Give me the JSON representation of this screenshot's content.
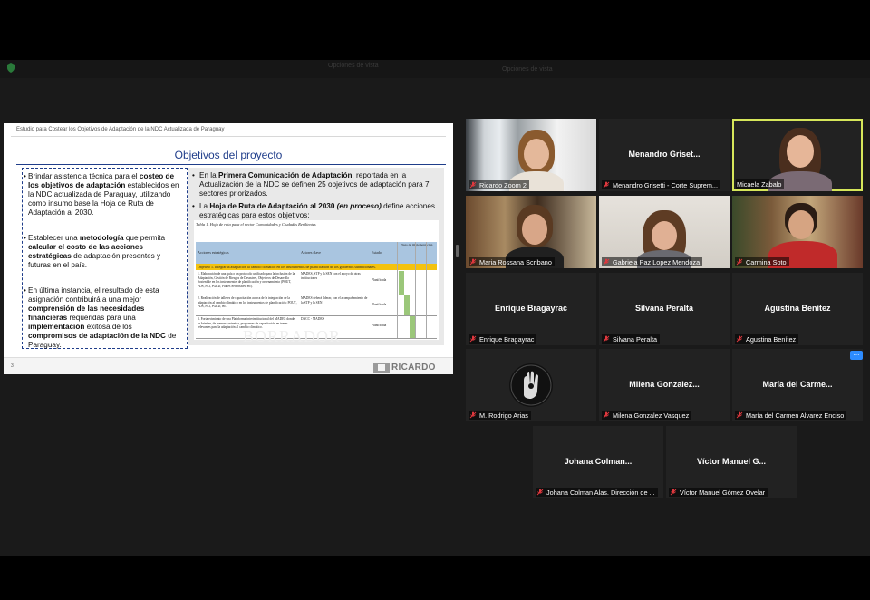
{
  "toolbar": {
    "view_label": "Opciones de vista",
    "view_label_2": "Opciones de vista"
  },
  "slide": {
    "header": "Estudio para Costear los Objetivos de Adaptación de la NDC Actualizada de Paraguay",
    "title": "Objetivos del proyecto",
    "left_items": [
      [
        "Brindar asistencia técnica para el ",
        "costeo de los objetivos de adaptación",
        " establecidos en la NDC actualizada de Paraguay, utilizando como insumo base la Hoja de Ruta de Adaptación al 2030."
      ],
      [
        "Establecer una ",
        "metodología",
        " que permita ",
        "calcular el costo de las acciones estratégicas",
        " de adaptación presentes y futuras en el país."
      ],
      [
        "En última instancia, el resultado de esta asignación contribuirá a una mejor ",
        "comprensión de las necesidades financieras",
        " requeridas para una ",
        "implementación",
        " exitosa de los ",
        "compromisos de adaptación de la NDC",
        " de Paraguay."
      ]
    ],
    "right_item_1": {
      "pre": "En la ",
      "bold": "Primera Comunicación de Adaptación",
      "post": ", reportada en la Actualización de la NDC se definen 25 objetivos de adaptación para 7 sectores priorizados."
    },
    "right_item_2": {
      "pre": "La ",
      "bold": "Hoja de Ruta de Adaptación al 2030",
      "ital": " (en proceso)",
      "post": " define acciones estratégicas para estos objetivos:"
    },
    "table": {
      "caption": "Tabla 1. Hoja de ruta para el sector Comunidades y Ciudades Resilientes",
      "col_actions": "Acciones estratégicas",
      "col_actors": "Actores clave",
      "col_status": "Estado",
      "col_period": "Plazo de implementación",
      "objective": "Objetivo 1. Integrar la adaptación al cambio climático en los instrumentos de planificación de los gobiernos subnacionales.",
      "rows": [
        {
          "action": "1. Elaboración de una guía o un protocolo unificado para la inclusión de la Adaptación, Gestión de Riesgos de Desastres, Objetivos de Desarrollo Sostenible en los instrumentos de planificación y ordenamiento (POUT, PDS, PEI, PGRD, Planes Sectoriales, etc).",
          "actor": "MADES, STP y la SEN con el apoyo de otras instituciones",
          "status": "Planificada"
        },
        {
          "action": "2. Realización de talleres de capacitación acerca de la integración de la adaptación al cambio climático en los instrumentos de planificación: POUT, PDS, PEI, PGRD, etc.",
          "actor": "MADES deberá liderar, con el acompañamiento de la STP y la SEN",
          "status": "Planificada"
        },
        {
          "action": "3. Fortalecimiento de una Plataforma interinstitucional del MADES donde se brinden, de manera sostenida, programas de capacitación en temas relevantes para la adaptación al cambio climático.",
          "actor": "DNCC - MADES",
          "status": "Planificada"
        }
      ],
      "watermark": "BORRADOR"
    },
    "page_number": "3",
    "logo_text": "RICARDO"
  },
  "participants": [
    {
      "name": "Ricardo Zoom 2",
      "video": true
    },
    {
      "name": "Menandro Grisetti - Corte Suprem...",
      "big": "Menandro Griset...",
      "video": false
    },
    {
      "name": "Micaela Zabalo",
      "video": true,
      "active": true
    },
    {
      "name": "Maria Rossana Scribano",
      "video": true
    },
    {
      "name": "Gabriela Paz Lopez Mendoza",
      "video": true
    },
    {
      "name": "Carmina Soto",
      "video": true
    },
    {
      "name": "Enrique Bragayrac",
      "big": "Enrique Bragayrac",
      "video": false
    },
    {
      "name": "Silvana Peralta",
      "big": "Silvana Peralta",
      "video": false
    },
    {
      "name": "Agustina Benítez",
      "big": "Agustina Benítez",
      "video": false,
      "more": "..."
    },
    {
      "name": "M. Rodrigo Arias",
      "video": false,
      "avatar": true
    },
    {
      "name": "Milena Gonzalez Vasquez",
      "big": "Milena  Gonzalez...",
      "video": false
    },
    {
      "name": "María del Carmen Alvarez Enciso",
      "big": "María del Carme...",
      "video": false
    },
    {
      "name": "Johana Colman Alas. Dirección de ...",
      "big": "Johana  Colman...",
      "video": false
    },
    {
      "name": "Víctor Manuel Gómez Ovelar",
      "big": "Víctor Manuel G...",
      "video": false
    }
  ],
  "colors": {
    "accent_active": "#d6e65a",
    "mic_muted": "#e0383e",
    "more_button": "#2d8cff"
  }
}
